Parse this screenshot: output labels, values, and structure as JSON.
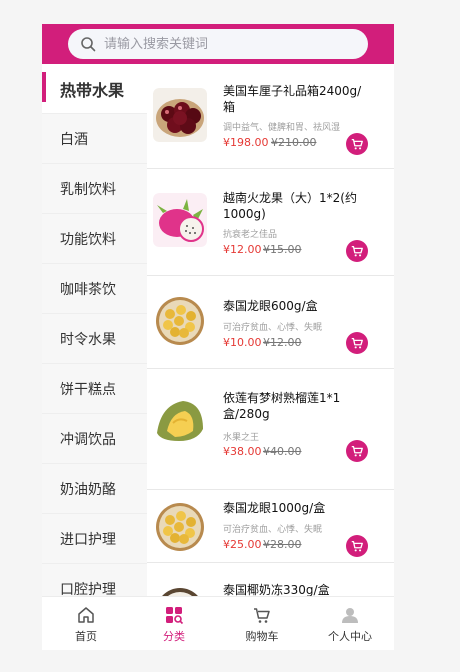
{
  "search": {
    "placeholder": "请输入搜索关键词"
  },
  "sidebar": {
    "items": [
      {
        "label": "热带水果",
        "active": true
      },
      {
        "label": "白酒"
      },
      {
        "label": "乳制饮料"
      },
      {
        "label": "功能饮料"
      },
      {
        "label": "咖啡茶饮"
      },
      {
        "label": "时令水果"
      },
      {
        "label": "饼干糕点"
      },
      {
        "label": "冲调饮品"
      },
      {
        "label": "奶油奶酪"
      },
      {
        "label": "进口护理"
      },
      {
        "label": "口腔护理"
      }
    ]
  },
  "products": [
    {
      "title": "美国车厘子礼品箱2400g/箱",
      "desc": "调中益气、健脾和胃、祛风湿",
      "price": "¥198.00",
      "old_price": "¥210.00",
      "image": "cherry"
    },
    {
      "title": "越南火龙果（大）1*2(约1000g)",
      "desc": "抗衰老之佳品",
      "price": "¥12.00",
      "old_price": "¥15.00",
      "image": "dragonfruit"
    },
    {
      "title": "泰国龙眼600g/盒",
      "desc": "可治疗贫血、心悸、失眠",
      "price": "¥10.00",
      "old_price": "¥12.00",
      "image": "longan"
    },
    {
      "title": "依莲有梦树熟榴莲1*1盒/280g",
      "desc": "水果之王",
      "price": "¥38.00",
      "old_price": "¥40.00",
      "image": "durian"
    },
    {
      "title": "泰国龙眼1000g/盒",
      "desc": "可治疗贫血、心悸、失眠",
      "price": "¥25.00",
      "old_price": "¥28.00",
      "image": "longan"
    },
    {
      "title": "泰国椰奶冻330g/盒",
      "desc": "",
      "price": "",
      "old_price": "",
      "image": "coconut"
    }
  ],
  "tabbar": {
    "home": "首页",
    "category": "分类",
    "cart": "购物车",
    "profile": "个人中心"
  },
  "colors": {
    "brand": "#d21e7b",
    "price": "#e53935"
  }
}
